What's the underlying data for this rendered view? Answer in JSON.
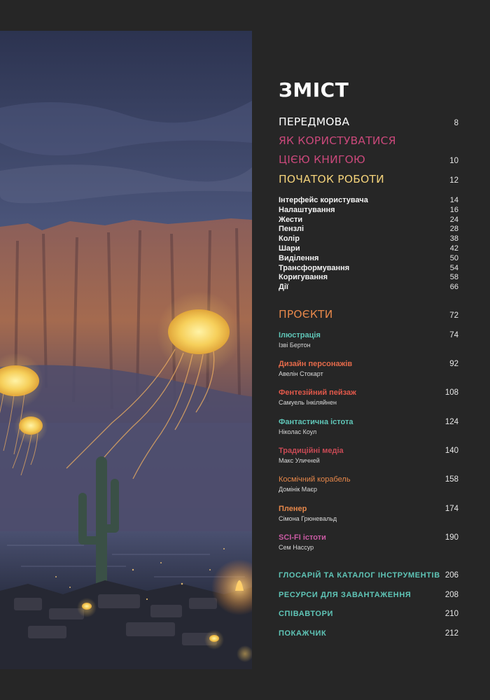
{
  "toc": {
    "title": "ЗМІСТ",
    "preface": {
      "label": "ПЕРЕДМОВА",
      "page": "8"
    },
    "howto": {
      "line1": "ЯК КОРИСТУВАТИСЯ",
      "line2": "ЦІЄЮ КНИГОЮ",
      "page": "10"
    },
    "start": {
      "label": "ПОЧАТОК РОБОТИ",
      "page": "12"
    },
    "start_items": [
      {
        "label": "Інтерфейс користувача",
        "page": "14"
      },
      {
        "label": "Налаштування",
        "page": "16"
      },
      {
        "label": "Жести",
        "page": "24"
      },
      {
        "label": "Пензлі",
        "page": "28"
      },
      {
        "label": "Колір",
        "page": "38"
      },
      {
        "label": "Шари",
        "page": "42"
      },
      {
        "label": "Виділення",
        "page": "50"
      },
      {
        "label": "Трансформування",
        "page": "54"
      },
      {
        "label": "Коригування",
        "page": "58"
      },
      {
        "label": "Дії",
        "page": "66"
      }
    ],
    "projects": {
      "label": "ПРОЄКТИ",
      "page": "72"
    },
    "project_items": [
      {
        "title": "Ілюстрація",
        "author": "Ізві Бертон",
        "page": "74",
        "color": "#5fc5b7"
      },
      {
        "title": "Дизайн персонажів",
        "author": "Авелін Стокарт",
        "page": "92",
        "color": "#e46a4a"
      },
      {
        "title": "Фентезійний пейзаж",
        "author": "Самуель Інкіляйнен",
        "page": "108",
        "color": "#e0584a"
      },
      {
        "title": "Фантастична істота",
        "author": "Ніколас Коул",
        "page": "124",
        "color": "#5fc5b7"
      },
      {
        "title": "Традиційні медіа",
        "author": "Макс Уличней",
        "page": "140",
        "color": "#c94a55"
      },
      {
        "title": "Космічний корабель",
        "author": "Домінік Маєр",
        "page": "158",
        "color": "#e6874a"
      },
      {
        "title": "Пленер",
        "author": "Сімона Грюневальд",
        "page": "174",
        "color": "#e6874a"
      },
      {
        "title": "SCI-FI істоти",
        "author": "Сем Нассур",
        "page": "190",
        "color": "#c95aa3"
      }
    ],
    "appendix": [
      {
        "label": "ГЛОСАРІЙ ТА КАТАЛОГ ІНСТРУМЕНТІВ",
        "page": "206"
      },
      {
        "label": "РЕСУРСИ ДЛЯ ЗАВАНТАЖЕННЯ",
        "page": "208"
      },
      {
        "label": "СПІВАВТОРИ",
        "page": "210"
      },
      {
        "label": "ПОКАЖЧИК",
        "page": "212"
      }
    ]
  },
  "colors": {
    "background": "#262626",
    "pink": "#c9487a",
    "yellow": "#f3d27a",
    "orange": "#e6874a",
    "teal": "#5fc5b7"
  }
}
